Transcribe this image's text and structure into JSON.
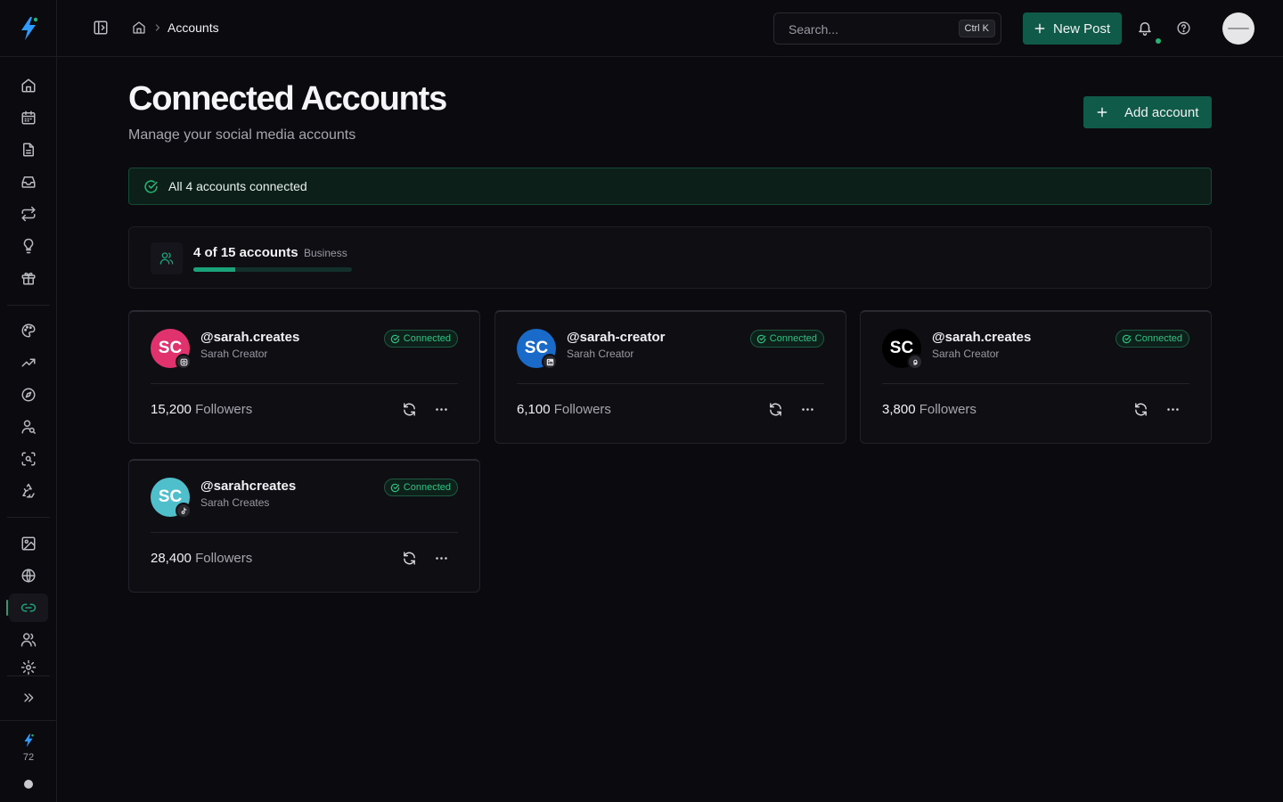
{
  "sidebar": {
    "logo_icon": "bolt-logo-icon",
    "nav_items": [
      {
        "name": "home",
        "icon": "home-icon"
      },
      {
        "name": "calendar",
        "icon": "calendar-icon"
      },
      {
        "name": "posts",
        "icon": "document-icon"
      },
      {
        "name": "inbox",
        "icon": "inbox-icon"
      },
      {
        "name": "repost",
        "icon": "repeat-icon"
      },
      {
        "name": "ideas",
        "icon": "lightbulb-icon"
      },
      {
        "name": "gifts",
        "icon": "gift-icon"
      },
      {
        "name": "brand",
        "icon": "palette-icon"
      },
      {
        "name": "analytics",
        "icon": "trending-icon"
      },
      {
        "name": "explore",
        "icon": "compass-icon"
      },
      {
        "name": "audience",
        "icon": "user-search-icon"
      },
      {
        "name": "scan",
        "icon": "scan-icon"
      },
      {
        "name": "recycle",
        "icon": "recycle-icon"
      },
      {
        "name": "media",
        "icon": "image-icon"
      },
      {
        "name": "web",
        "icon": "globe-icon"
      },
      {
        "name": "accounts",
        "icon": "link-icon",
        "active": true
      },
      {
        "name": "team",
        "icon": "users-icon"
      },
      {
        "name": "settings",
        "icon": "gear-icon"
      }
    ],
    "expand_icon": "chevrons-right-icon",
    "credits": "72"
  },
  "header": {
    "breadcrumb": {
      "current": "Accounts"
    },
    "search": {
      "placeholder": "Search...",
      "shortcut": "Ctrl K"
    },
    "new_post_label": "New Post"
  },
  "page": {
    "title": "Connected Accounts",
    "subtitle": "Manage your social media accounts",
    "add_account_label": "Add account"
  },
  "banner": {
    "text": "All 4 accounts connected"
  },
  "quota": {
    "count_text": "4 of 15 accounts",
    "plan": "Business",
    "used": 4,
    "limit": 15
  },
  "accounts": [
    {
      "initials": "SC",
      "handle": "@sarah.creates",
      "name": "Sarah Creator",
      "status": "Connected",
      "followers": "15,200",
      "followers_label": "Followers",
      "platform": "instagram",
      "avatar_color": "#e0336e"
    },
    {
      "initials": "SC",
      "handle": "@sarah-creator",
      "name": "Sarah Creator",
      "status": "Connected",
      "followers": "6,100",
      "followers_label": "Followers",
      "platform": "linkedin",
      "avatar_color": "#1a6bc9"
    },
    {
      "initials": "SC",
      "handle": "@sarah.creates",
      "name": "Sarah Creator",
      "status": "Connected",
      "followers": "3,800",
      "followers_label": "Followers",
      "platform": "threads",
      "avatar_color": "#000000"
    },
    {
      "initials": "SC",
      "handle": "@sarahcreates",
      "name": "Sarah Creates",
      "status": "Connected",
      "followers": "28,400",
      "followers_label": "Followers",
      "platform": "tiktok",
      "avatar_color": "#4fbfcc"
    }
  ]
}
